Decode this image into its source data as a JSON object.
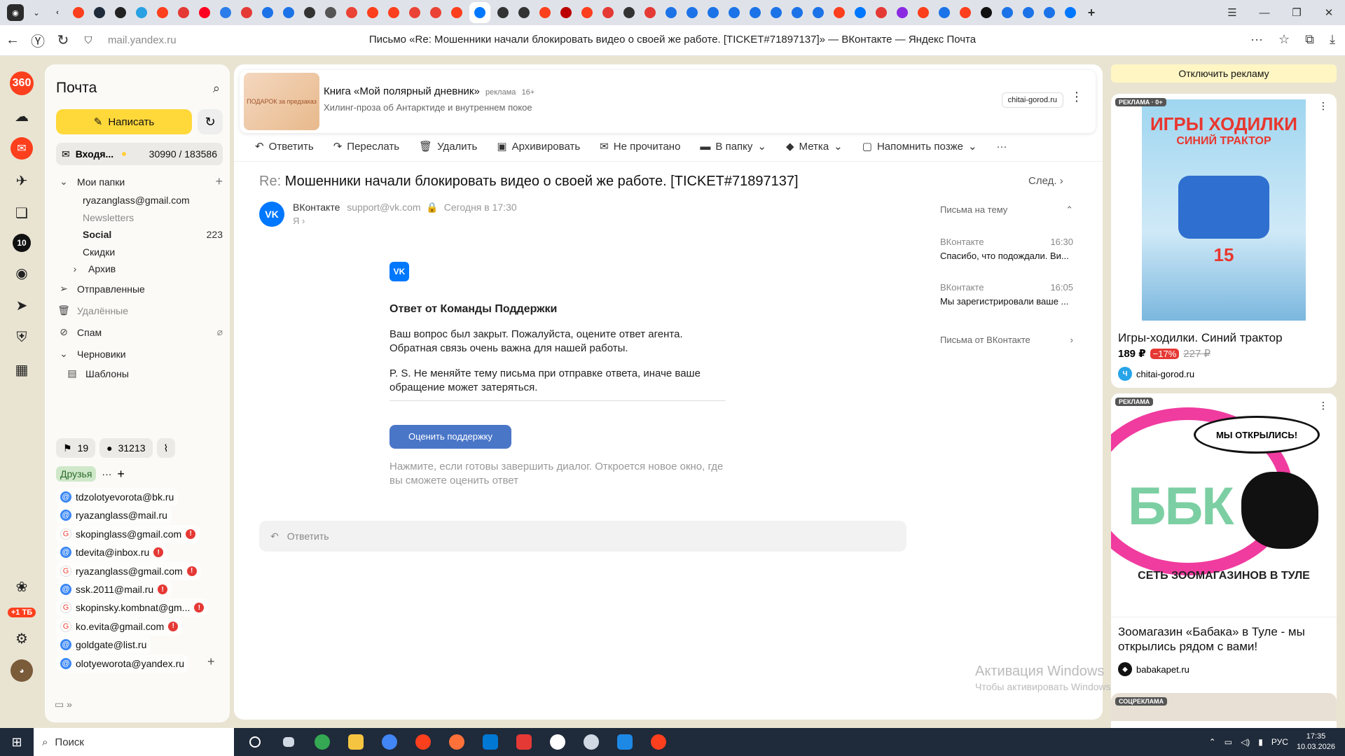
{
  "browser": {
    "url": "mail.yandex.ru",
    "page_title": "Письмо «Re: Мошенники начали блокировать видео о своей же работе. [TICKET#71897137]» — ВКонтакте — Яндекс Почта",
    "tab_colors": [
      "#fc3f1d",
      "#1f2a3a",
      "#222",
      "#2aa1e2",
      "#fc3f1d",
      "#e53935",
      "#f02",
      "#2b7de9",
      "#e53935",
      "#1c73e8",
      "#1c73e8",
      "#333",
      "#555",
      "#ea4335",
      "#fc3f1d",
      "#fc3f1d",
      "#ea4335",
      "#ea4335",
      "#fc3f1d",
      "#0077ff",
      "#333",
      "#333",
      "#fc3f1d",
      "#b00",
      "#fc3f1d",
      "#e53935",
      "#333",
      "#e53935",
      "#1c73e8",
      "#1c73e8",
      "#1c73e8",
      "#1c73e8",
      "#1c73e8",
      "#1c73e8",
      "#1c73e8",
      "#1c73e8",
      "#fc3f1d",
      "#0077ff",
      "#e53935",
      "#8a2be2",
      "#fc3f1d",
      "#1c73e8",
      "#fc3f1d",
      "#111",
      "#1c73e8",
      "#1c73e8",
      "#1c73e8",
      "#0077ff"
    ]
  },
  "rail": {
    "storage_badge": "+1 ТБ",
    "badge_10": "10"
  },
  "sidebar": {
    "title": "Почта",
    "compose": "Написать",
    "inbox_label": "Входя...",
    "inbox_count": "30990 / 183586",
    "my_folders": "Мои папки",
    "folders": [
      {
        "label": "ryazanglass@gmail.com",
        "count": ""
      },
      {
        "label": "Newsletters",
        "count": ""
      },
      {
        "label": "Social",
        "count": "223"
      },
      {
        "label": "Скидки",
        "count": ""
      },
      {
        "label": "Архив",
        "count": ""
      }
    ],
    "sent": "Отправленные",
    "deleted": "Удалённые",
    "spam": "Спам",
    "drafts": "Черновики",
    "templates": "Шаблоны",
    "bookmarks_count": "19",
    "unread_count": "31213",
    "friends_tag": "Друзья",
    "accounts": [
      {
        "email": "tdzolotyevorota@bk.ru",
        "type": "at",
        "warn": false
      },
      {
        "email": "ryazanglass@mail.ru",
        "type": "at",
        "warn": false
      },
      {
        "email": "skopinglass@gmail.com",
        "type": "g",
        "warn": true
      },
      {
        "email": "tdevita@inbox.ru",
        "type": "at",
        "warn": true
      },
      {
        "email": "ryazanglass@gmail.com",
        "type": "g",
        "warn": true
      },
      {
        "email": "ssk.2011@mail.ru",
        "type": "at",
        "warn": true
      },
      {
        "email": "skopinsky.kombnat@gm...",
        "type": "g",
        "warn": true
      },
      {
        "email": "ko.evita@gmail.com",
        "type": "g",
        "warn": true
      },
      {
        "email": "goldgate@list.ru",
        "type": "at",
        "warn": false
      },
      {
        "email": "olotyeworota@yandex.ru",
        "type": "at",
        "warn": false
      }
    ]
  },
  "ad_top": {
    "title": "Книга «Мой полярный дневник»",
    "tag": "реклама",
    "age": "16+",
    "subtitle": "Хилинг-проза об Антарктиде и внутреннем покое",
    "domain": "chitai-gorod.ru",
    "thumb_text": "ПОДАРОК за предзаказ"
  },
  "toolbar": {
    "reply": "Ответить",
    "forward": "Переслать",
    "delete": "Удалить",
    "archive": "Архивировать",
    "unread": "Не прочитано",
    "to_folder": "В папку",
    "label": "Метка",
    "remind": "Напомнить позже"
  },
  "message": {
    "re": "Re:",
    "subject": "Мошенники начали блокировать видео о своей же работе. [TICKET#71897137]",
    "next": "След.",
    "sender_name": "ВКонтакте",
    "sender_email": "support@vk.com",
    "date": "Сегодня в 17:30",
    "to": "Я",
    "heading": "Ответ от Команды Поддержки",
    "para1": "Ваш вопрос был закрыт. Пожалуйста, оцените ответ агента. Обратная связь очень важна для нашей работы.",
    "para2": "P. S. Не меняйте тему письма при отправке ответа, иначе ваше обращение может затеряться.",
    "button": "Оценить поддержку",
    "note": "Нажмите, если готовы завершить диалог. Откроется новое окно, где вы сможете оценить ответ",
    "reply_placeholder": "Ответить"
  },
  "thread": {
    "header": "Письма на тему",
    "items": [
      {
        "from": "ВКонтакте",
        "time": "16:30",
        "snippet": "Спасибо, что подождали. Ви..."
      },
      {
        "from": "ВКонтакте",
        "time": "16:05",
        "snippet": "Мы зарегистрировали ваше ..."
      }
    ],
    "from_link": "Письма от ВКонтакте"
  },
  "watermark": {
    "title": "Активация Windows",
    "sub": "Чтобы активировать Windows, перейдите в раздел \"Параметры\"."
  },
  "right_ads": {
    "disable": "Отключить рекламу",
    "ad1_label": "РЕКЛАМА · 0+",
    "ad1_book_title": "ИГРЫ ХОДИЛКИ",
    "ad1_book_sub": "СИНИЙ ТРАКТОР",
    "ad1_book_count": "15",
    "ad1_title": "Игры-ходилки. Синий трактор",
    "ad1_price": "189 ₽",
    "ad1_discount": "−17%",
    "ad1_old_price": "227 ₽",
    "ad1_domain": "chitai-gorod.ru",
    "ad2_label": "РЕКЛАМА",
    "ad2_bubble": "МЫ ОТКРЫЛИСЬ!",
    "ad2_logo": "ББК",
    "ad2_network": "СЕТЬ ЗООМАГАЗИНОВ В ТУЛЕ",
    "ad2_title": "Зоомагазин «Бабака» в Туле - мы открылись рядом с вами!",
    "ad2_domain": "babakapet.ru",
    "ad3_label": "СОЦРЕКЛАМА"
  },
  "taskbar": {
    "search": "Поиск",
    "lang": "РУС",
    "time": "17:35",
    "date": "10.03.2026"
  }
}
